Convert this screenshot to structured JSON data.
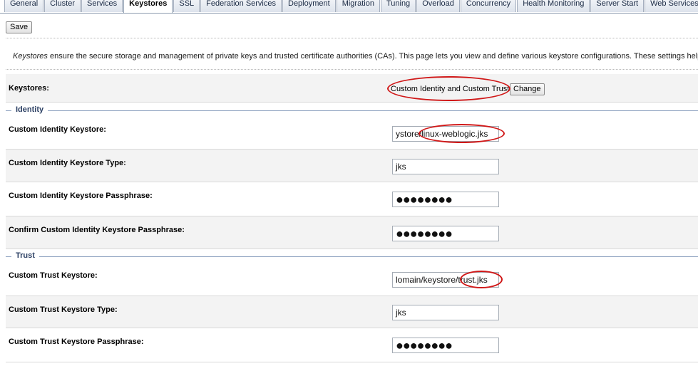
{
  "tabs": [
    {
      "label": "General",
      "active": false
    },
    {
      "label": "Cluster",
      "active": false
    },
    {
      "label": "Services",
      "active": false
    },
    {
      "label": "Keystores",
      "active": true
    },
    {
      "label": "SSL",
      "active": false
    },
    {
      "label": "Federation Services",
      "active": false
    },
    {
      "label": "Deployment",
      "active": false
    },
    {
      "label": "Migration",
      "active": false
    },
    {
      "label": "Tuning",
      "active": false
    },
    {
      "label": "Overload",
      "active": false
    },
    {
      "label": "Concurrency",
      "active": false
    },
    {
      "label": "Health Monitoring",
      "active": false
    },
    {
      "label": "Server Start",
      "active": false
    },
    {
      "label": "Web Services",
      "active": false
    }
  ],
  "toolbar": {
    "save_label": "Save"
  },
  "intro": {
    "keyword": "Keystores",
    "text": " ensure the secure storage and management of private keys and trusted certificate authorities (CAs). This page lets you view and define various keystore configurations. These settings help"
  },
  "keystores": {
    "label": "Keystores:",
    "value": "Custom Identity and Custom Trust",
    "change_label": "Change"
  },
  "identity": {
    "title": "Identity",
    "keystore_label": "Custom Identity Keystore:",
    "keystore_value": "ystore/linux-weblogic.jks",
    "type_label": "Custom Identity Keystore Type:",
    "type_value": "jks",
    "pass_label": "Custom Identity Keystore Passphrase:",
    "pass_value": "●●●●●●●●",
    "confirm_label": "Confirm Custom Identity Keystore Passphrase:",
    "confirm_value": "●●●●●●●●"
  },
  "trust": {
    "title": "Trust",
    "keystore_label": "Custom Trust Keystore:",
    "keystore_value": "lomain/keystore/trust.jks",
    "type_label": "Custom Trust Keystore Type:",
    "type_value": "jks",
    "pass_label": "Custom Trust Keystore Passphrase:",
    "pass_value": "●●●●●●●●"
  },
  "colors": {
    "annotation": "#d01818",
    "section_title": "#2b3f63"
  }
}
